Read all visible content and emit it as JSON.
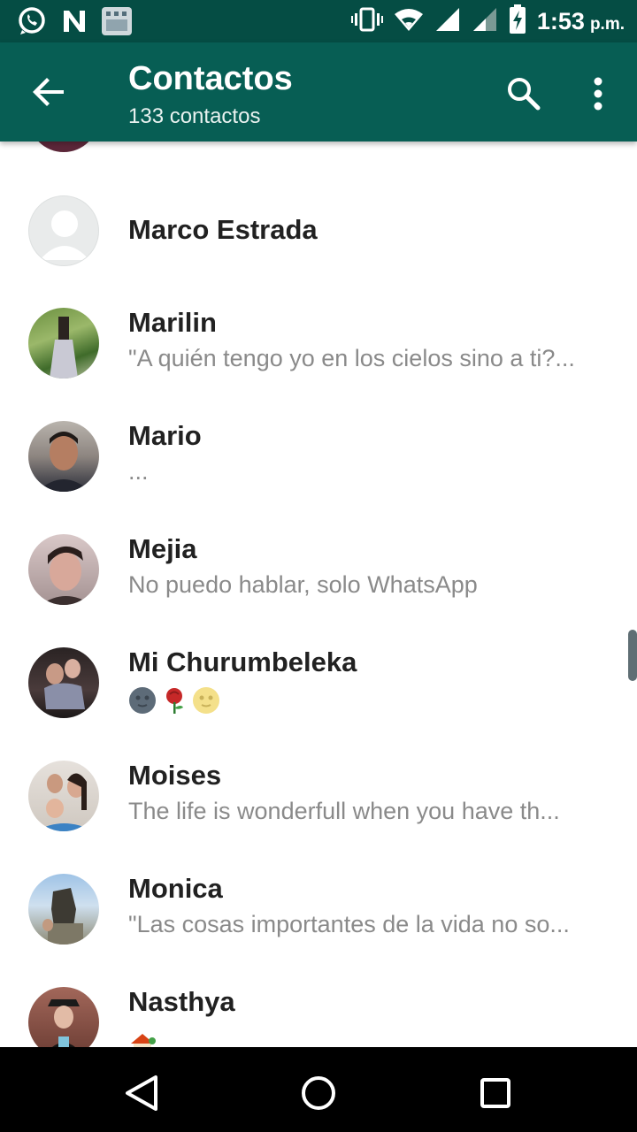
{
  "status_bar": {
    "time": "1:53",
    "ampm": "p.m.",
    "icons": [
      "whatsapp-notification-icon",
      "n-notification-icon",
      "calendar-notification-icon",
      "vibrate-icon",
      "wifi-icon",
      "signal-icon",
      "signal-weak-icon",
      "battery-charging-icon"
    ]
  },
  "app_bar": {
    "title": "Contactos",
    "subtitle": "133 contactos",
    "back_icon": "arrow-back-icon",
    "search_icon": "search-icon",
    "menu_icon": "more-vert-icon",
    "background": "#075e54",
    "status_background": "#054d44"
  },
  "contacts": [
    {
      "name": "Marco Estrada",
      "status": ""
    },
    {
      "name": "Marilin",
      "status": "\"A quién tengo yo en los cielos sino a ti?..."
    },
    {
      "name": "Mario",
      "status": "..."
    },
    {
      "name": "Mejia",
      "status": "No puedo hablar, solo WhatsApp"
    },
    {
      "name": "Mi Churumbeleka",
      "status": "🌚🌹🌝"
    },
    {
      "name": "Moises",
      "status": "The life is wonderfull when you have th..."
    },
    {
      "name": "Monica",
      "status": "\"Las cosas importantes de la vida no so..."
    },
    {
      "name": "Nasthya",
      "status": "🏡"
    }
  ],
  "nav_bar": {
    "back": "nav-back-icon",
    "home": "nav-home-icon",
    "recents": "nav-recents-icon"
  }
}
